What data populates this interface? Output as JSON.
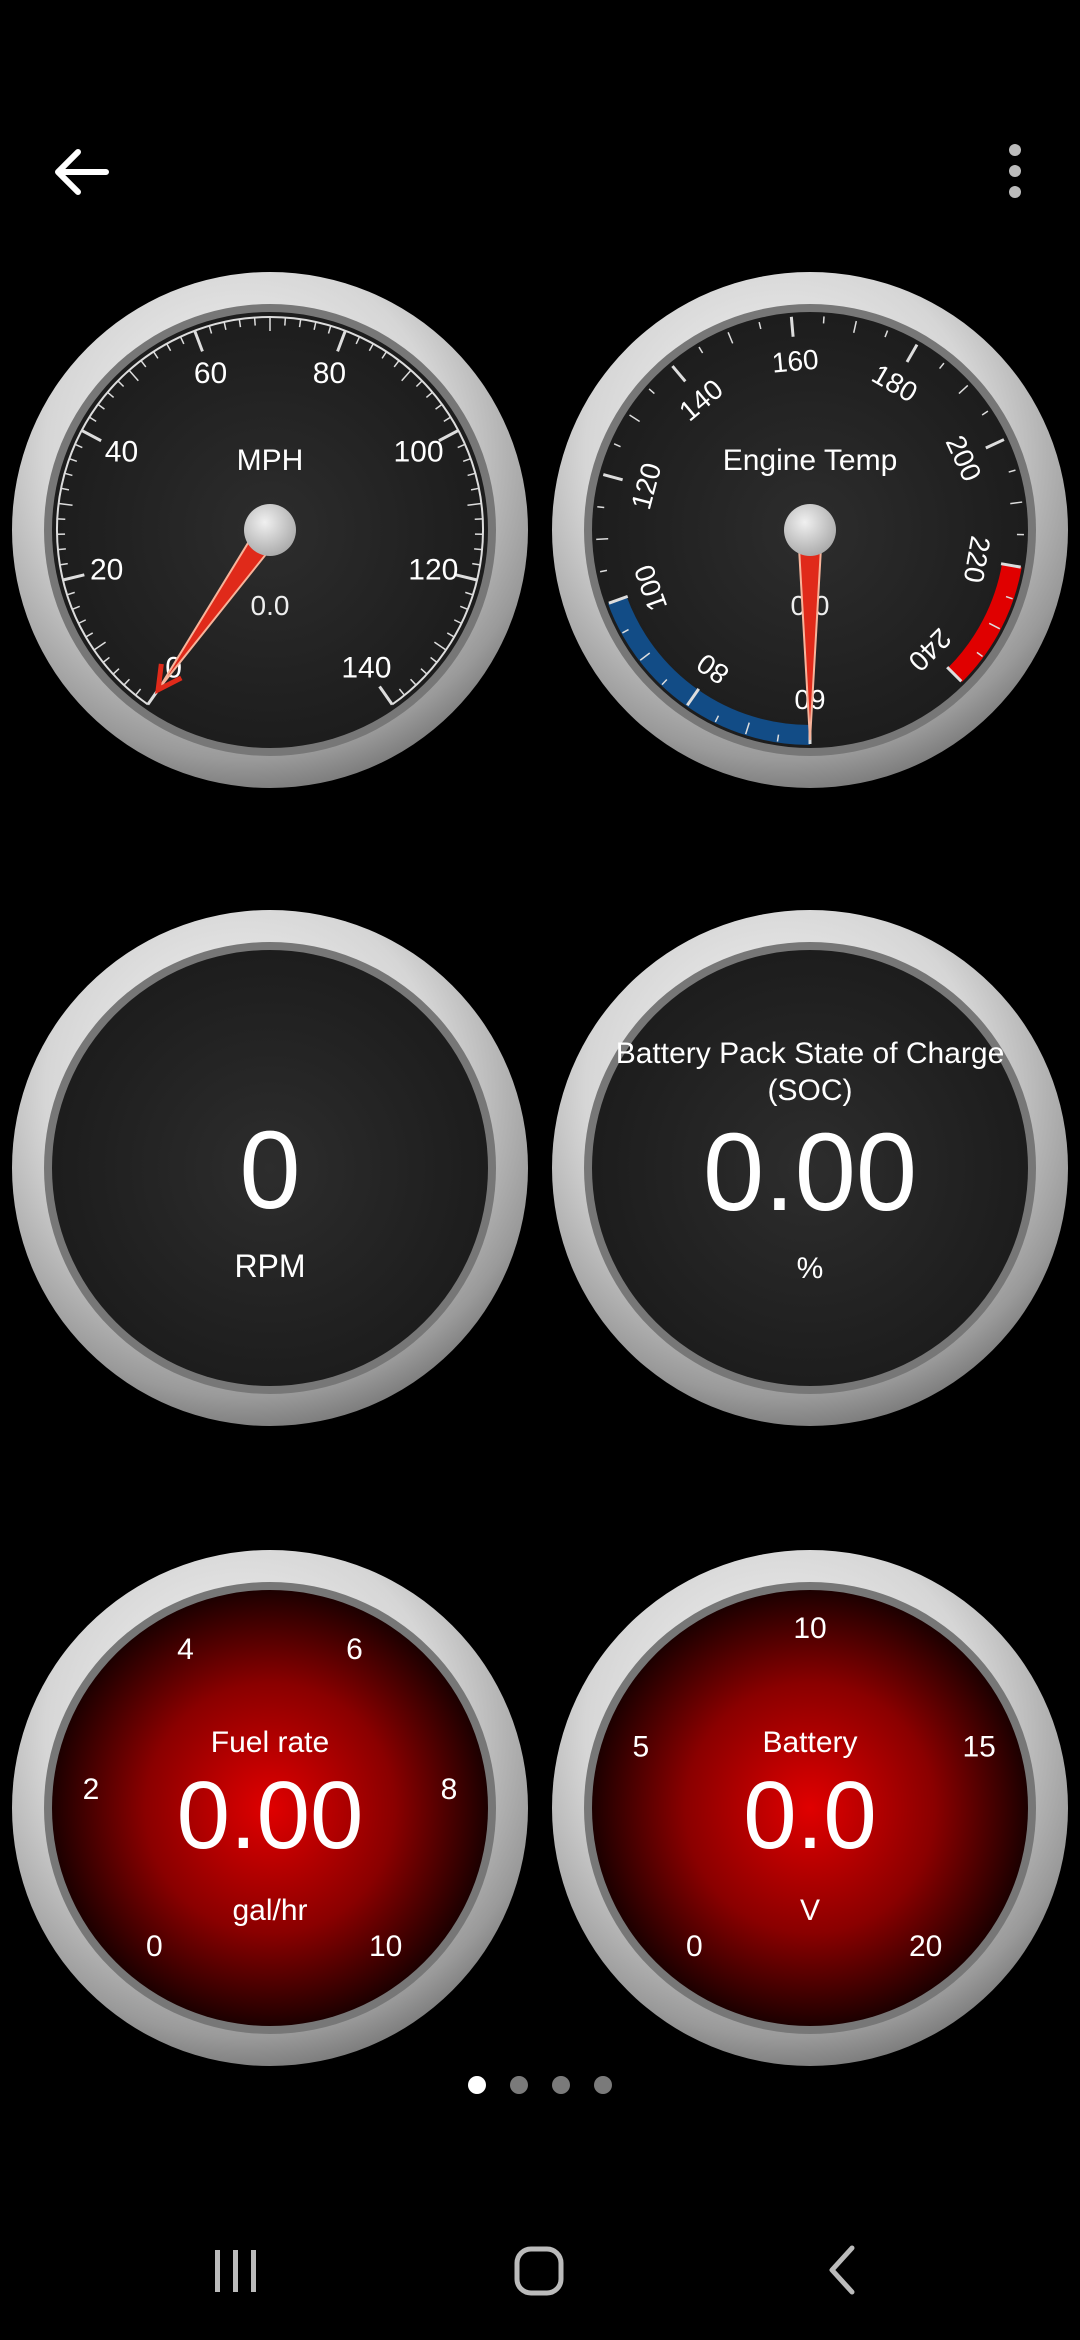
{
  "colors": {
    "background": "#000000",
    "needle": "#e02a1a",
    "cold_zone": "#124c86",
    "hot_zone": "#e00000",
    "red_face": "#c40000"
  },
  "toolbar": {
    "back_icon": "arrow-left-icon",
    "menu_icon": "more-vertical-icon"
  },
  "gauges": {
    "speed": {
      "title": "MPH",
      "value": "0.0",
      "needle_value": 0,
      "ticks": [
        "0",
        "20",
        "40",
        "60",
        "80",
        "100",
        "120",
        "140"
      ]
    },
    "engine_temp": {
      "title": "Engine Temp",
      "value": "0.0",
      "needle_value": 0,
      "ticks": [
        "60",
        "80",
        "100",
        "120",
        "140",
        "160",
        "180",
        "200",
        "220",
        "240"
      ]
    },
    "rpm": {
      "value": "0",
      "unit": "RPM"
    },
    "soc": {
      "title_line1": "Battery Pack State of Charge",
      "title_line2": "(SOC)",
      "value": "0.00",
      "unit": "%"
    },
    "fuel_rate": {
      "title": "Fuel rate",
      "value": "0.00",
      "unit": "gal/hr",
      "ticks": [
        "0",
        "2",
        "4",
        "6",
        "8",
        "10"
      ]
    },
    "battery": {
      "title": "Battery",
      "value": "0.0",
      "unit": "V",
      "ticks": [
        "0",
        "5",
        "10",
        "15",
        "20"
      ]
    }
  },
  "pager": {
    "count": 4,
    "active": 0
  },
  "nav": {
    "recents_icon": "recents-icon",
    "home_icon": "home-icon",
    "back_icon": "chevron-left-icon"
  }
}
